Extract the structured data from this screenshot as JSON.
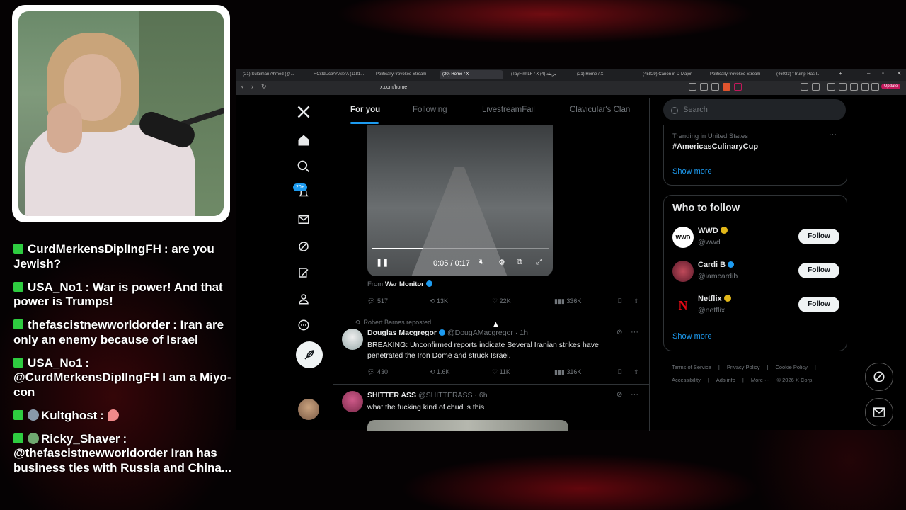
{
  "chat": [
    {
      "user": "CurdMerkensDiplIngFH",
      "text": "are you Jewish?"
    },
    {
      "user": "USA_No1",
      "text": "War is power! And that power is Trumps!"
    },
    {
      "user": "thefascistnewworldorder",
      "text": "Iran are only an enemy because of Israel"
    },
    {
      "user": "USA_No1",
      "text": "@CurdMerkensDiplIngFH I am a Miyo-con"
    },
    {
      "user": "Kultghost",
      "text": ""
    },
    {
      "user": "Ricky_Shaver",
      "text": "@thefascistnewworldorder Iran has business ties with Russia and China..."
    }
  ],
  "browser": {
    "tabs": [
      "(21) Sulaiman Ahmed (@...",
      "HCxIdUcbAAAlerA (1181...",
      "PoliticallyProvoked Stream",
      "(20) Home / X",
      "(TayFirmLF / X مزيفة (4)",
      "(21) Home / X",
      "(45829) Canon in D Major",
      "PoliticallyProvoked Stream",
      "(46033) \"Trump Has I..."
    ],
    "url": "x.com/home",
    "update_label": "Update"
  },
  "nav": {
    "notifications_badge": "20+",
    "icons": [
      "x-logo-icon",
      "home-icon",
      "search-icon",
      "bell-icon",
      "mail-icon",
      "grok-icon",
      "premium-icon",
      "profile-icon",
      "more-icon"
    ]
  },
  "feed": {
    "tabs": [
      "For you",
      "Following",
      "LivestreamFail",
      "Clavicular's Clan"
    ],
    "video": {
      "time": "0:05 / 0:17",
      "progress": 0.29
    },
    "post1": {
      "from_label": "From",
      "from_name": "War Monitor",
      "replies": "517",
      "reposts": "13K",
      "likes": "22K",
      "views": "336K"
    },
    "post2": {
      "repost_label": "Robert Barnes reposted",
      "name": "Douglas Macgregor",
      "handle": "@DougAMacgregor",
      "time": "· 1h",
      "text": "BREAKING:  Unconfirmed reports indicate Several Iranian strikes have penetrated the Iron Dome and struck Israel.",
      "replies": "430",
      "reposts": "1.6K",
      "likes": "11K",
      "views": "316K"
    },
    "post3": {
      "name": "SHITTER ASS",
      "handle": "@SHITTERASS",
      "time": "· 6h",
      "text": "what the fucking kind of chud is this"
    }
  },
  "sidebar": {
    "search_placeholder": "Search",
    "trend_sub": "Trending in United States",
    "trend_name": "#AmericasCulinaryCup",
    "show_more": "Show more",
    "who_to_follow": "Who to follow",
    "accounts": [
      {
        "name": "WWD",
        "handle": "@wwd",
        "follow": "Follow",
        "avatar_text": "WWD"
      },
      {
        "name": "Cardi B",
        "handle": "@iamcardib",
        "follow": "Follow",
        "avatar_text": ""
      },
      {
        "name": "Netflix",
        "handle": "@netflix",
        "follow": "Follow",
        "avatar_text": "N"
      }
    ],
    "footer": [
      "Terms of Service",
      "|",
      "Privacy Policy",
      "|",
      "Cookie Policy",
      "|",
      "Accessibility",
      "|",
      "Ads info",
      "|",
      "More ···",
      "© 2026 X Corp."
    ]
  },
  "colors": {
    "accent": "#1d9bf0",
    "chat_badge": "#2ecc40",
    "background": "#000000"
  }
}
